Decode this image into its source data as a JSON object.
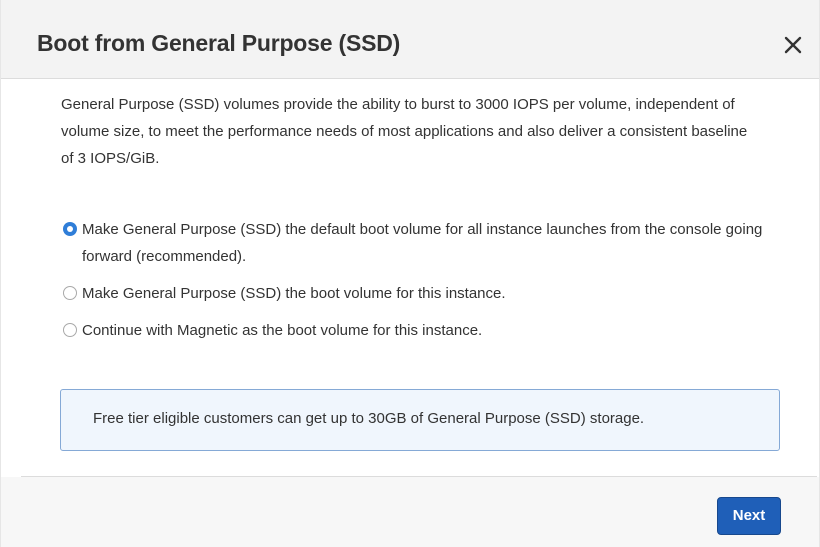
{
  "dialog": {
    "title": "Boot from General Purpose (SSD)",
    "close_icon": "close-icon",
    "description": "General Purpose (SSD) volumes provide the ability to burst to 3000 IOPS per volume, independent of volume size, to meet the performance needs of most applications and also deliver a consistent baseline of 3 IOPS/GiB."
  },
  "options": [
    {
      "label": "Make General Purpose (SSD) the default boot volume for all instance launches from the console going forward (recommended).",
      "selected": true
    },
    {
      "label": "Make General Purpose (SSD) the boot volume for this instance.",
      "selected": false
    },
    {
      "label": "Continue with Magnetic as the boot volume for this instance.",
      "selected": false
    }
  ],
  "info": {
    "text": "Free tier eligible customers can get up to 30GB of General Purpose (SSD) storage."
  },
  "footer": {
    "next_label": "Next"
  },
  "colors": {
    "accent": "#1f5fb8",
    "radio_selected": "#2f7ed8",
    "info_border": "#85a9d6",
    "info_background": "#f0f6fd"
  }
}
